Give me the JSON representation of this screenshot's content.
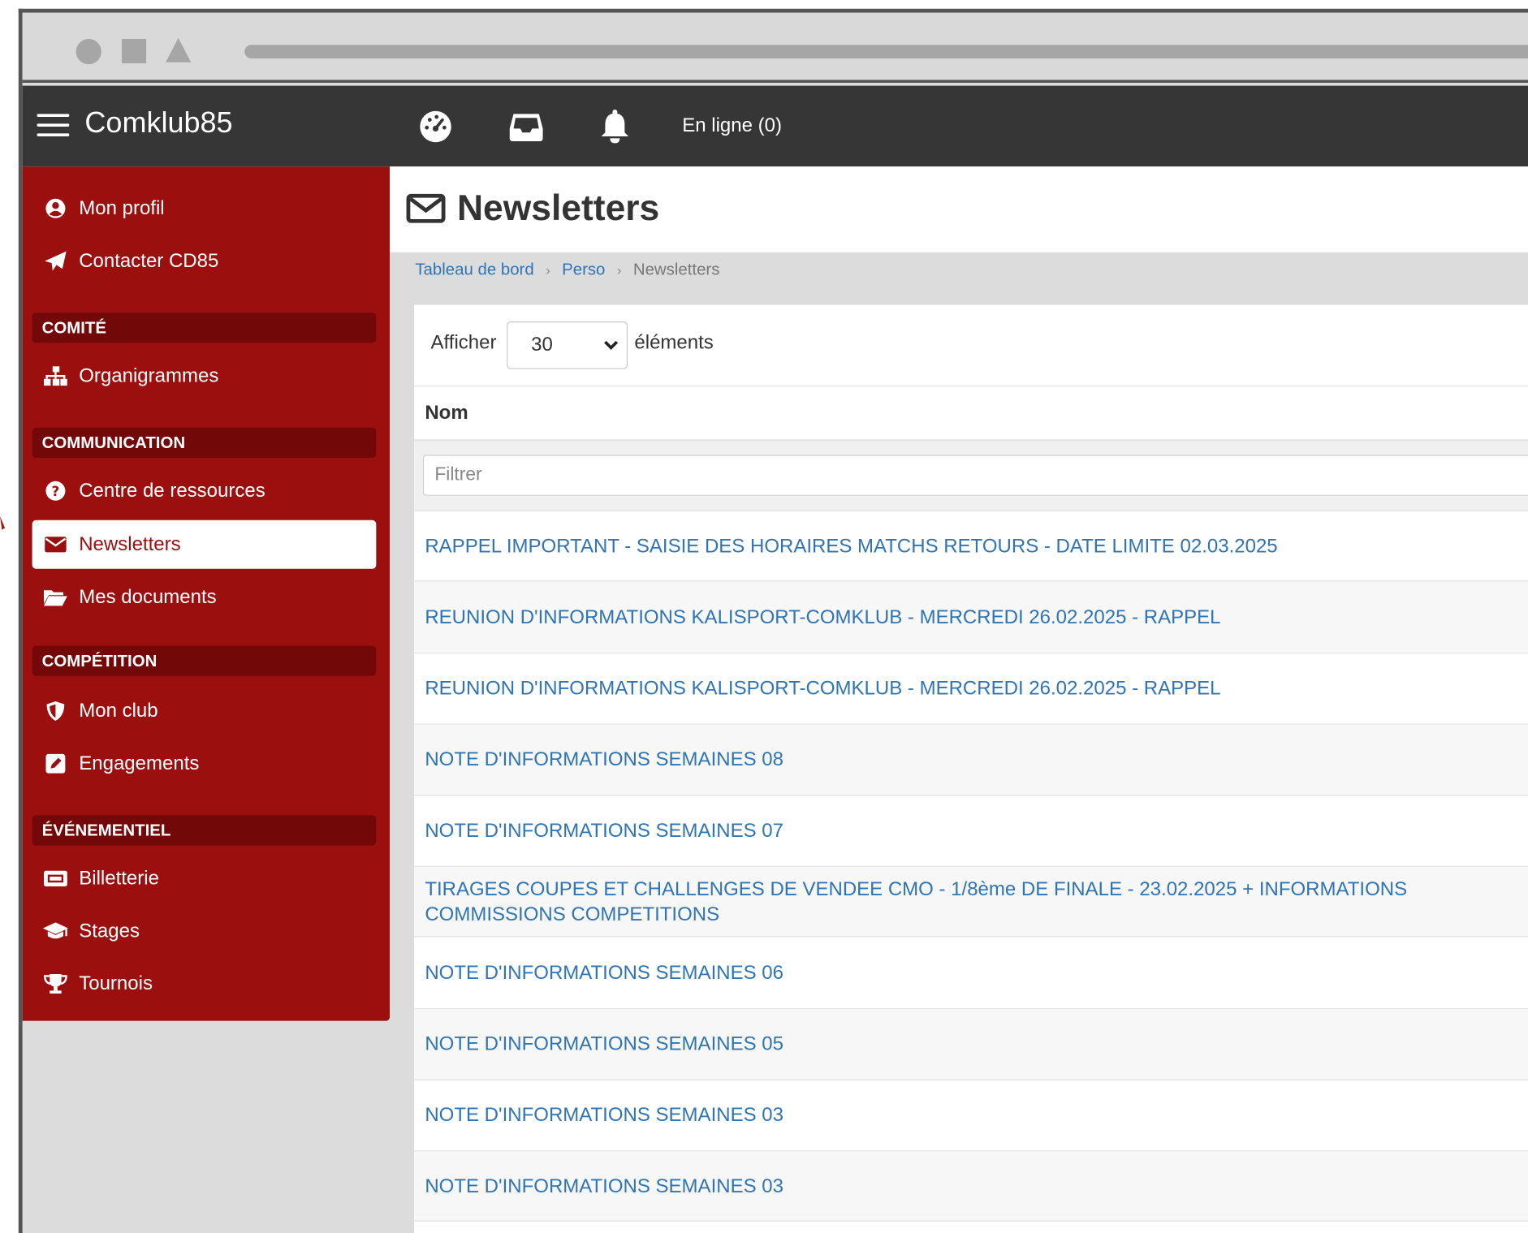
{
  "app": {
    "brand": "Comklub85",
    "online_label": "En ligne (0)"
  },
  "topnav_icons": [
    "dashboard-icon",
    "inbox-icon",
    "bell-icon"
  ],
  "sidebar": {
    "items": [
      {
        "label": "Mon profil",
        "icon": "user-circle-icon"
      },
      {
        "label": "Contacter CD85",
        "icon": "paper-plane-icon"
      }
    ],
    "sections": [
      {
        "header": "COMITÉ",
        "items": [
          {
            "label": "Organigrammes",
            "icon": "sitemap-icon"
          }
        ]
      },
      {
        "header": "COMMUNICATION",
        "items": [
          {
            "label": "Centre de ressources",
            "icon": "question-circle-icon"
          },
          {
            "label": "Newsletters",
            "icon": "envelope-icon",
            "active": true
          },
          {
            "label": "Mes documents",
            "icon": "folder-open-icon"
          }
        ]
      },
      {
        "header": "COMPÉTITION",
        "items": [
          {
            "label": "Mon club",
            "icon": "shield-icon"
          },
          {
            "label": "Engagements",
            "icon": "edit-square-icon"
          }
        ]
      },
      {
        "header": "ÉVÉNEMENTIEL",
        "items": [
          {
            "label": "Billetterie",
            "icon": "ticket-icon"
          },
          {
            "label": "Stages",
            "icon": "graduation-cap-icon"
          },
          {
            "label": "Tournois",
            "icon": "trophy-icon"
          }
        ]
      }
    ]
  },
  "page": {
    "title": "Newsletters",
    "breadcrumb": [
      "Tableau de bord",
      "Perso",
      "Newsletters"
    ]
  },
  "table": {
    "length_prefix": "Afficher",
    "length_value": "30",
    "length_suffix": "éléments",
    "column_header": "Nom",
    "filter_placeholder": "Filtrer",
    "rows": [
      "RAPPEL IMPORTANT - SAISIE DES HORAIRES MATCHS RETOURS - DATE LIMITE 02.03.2025",
      "REUNION D'INFORMATIONS KALISPORT-COMKLUB - MERCREDI 26.02.2025 - RAPPEL",
      "REUNION D'INFORMATIONS KALISPORT-COMKLUB - MERCREDI 26.02.2025 - RAPPEL",
      "NOTE D'INFORMATIONS SEMAINES 08",
      "NOTE D'INFORMATIONS SEMAINES 07",
      "TIRAGES COUPES ET CHALLENGES DE VENDEE CMO - 1/8ème DE FINALE - 23.02.2025 + INFORMATIONS COMMISSIONS COMPETITIONS",
      "NOTE D'INFORMATIONS SEMAINES 06",
      "NOTE D'INFORMATIONS SEMAINES 05",
      "NOTE D'INFORMATIONS SEMAINES 03",
      "NOTE D'INFORMATIONS SEMAINES 03"
    ]
  },
  "colors": {
    "sidebar_bg": "#9b0f0f",
    "sidebar_header_bg": "#730808",
    "topnav_bg": "#363636",
    "link": "#2f74b5"
  }
}
